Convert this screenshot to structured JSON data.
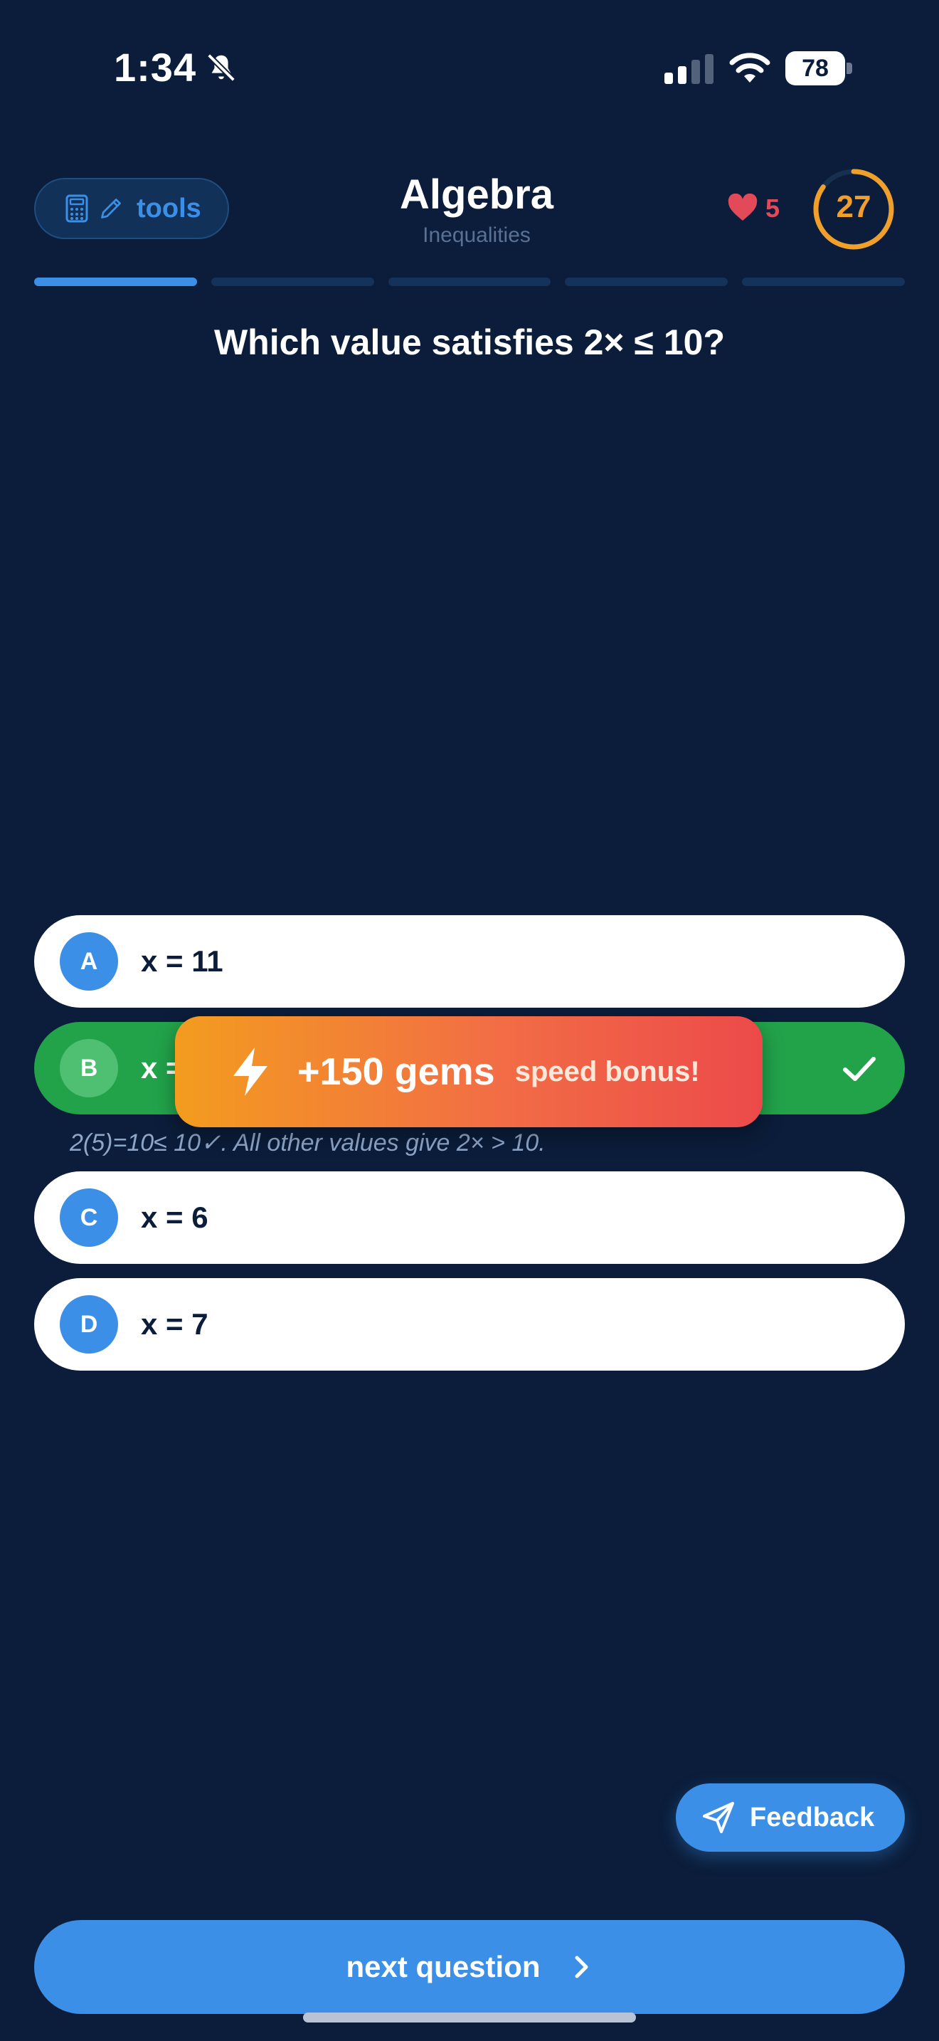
{
  "status_bar": {
    "time": "1:34",
    "battery": "78"
  },
  "header": {
    "tools_label": "tools",
    "title": "Algebra",
    "subtitle": "Inequalities",
    "lives": "5",
    "timer": "27",
    "timer_fraction": 0.85
  },
  "progress": {
    "segments": 5,
    "current": 1
  },
  "question": "Which value satisfies 2× ≤ 10?",
  "answers": [
    {
      "letter": "A",
      "text": "x = 11",
      "state": "default"
    },
    {
      "letter": "B",
      "text": "x =",
      "state": "correct"
    },
    {
      "letter": "C",
      "text": "x = 6",
      "state": "default"
    },
    {
      "letter": "D",
      "text": "x = 7",
      "state": "default"
    }
  ],
  "bonus": {
    "gems": "+150 gems",
    "label": "speed bonus!"
  },
  "explanation": "2(5)=10≤ 10✓. All other values give 2× > 10.",
  "feedback_label": "Feedback",
  "next_label": "next question",
  "icons": {
    "tools": [
      "calculator-icon",
      "pencil-icon"
    ],
    "lives": "heart-icon",
    "bonus": "lightning-icon",
    "feedback": "send-icon",
    "next": "chevron-right-icon",
    "correct": "checkmark-icon"
  },
  "colors": {
    "background": "#0b1d3a",
    "accent": "#3b8fe6",
    "correct": "#22a34a",
    "timer": "#f0a02a",
    "heart": "#e24a5a"
  }
}
